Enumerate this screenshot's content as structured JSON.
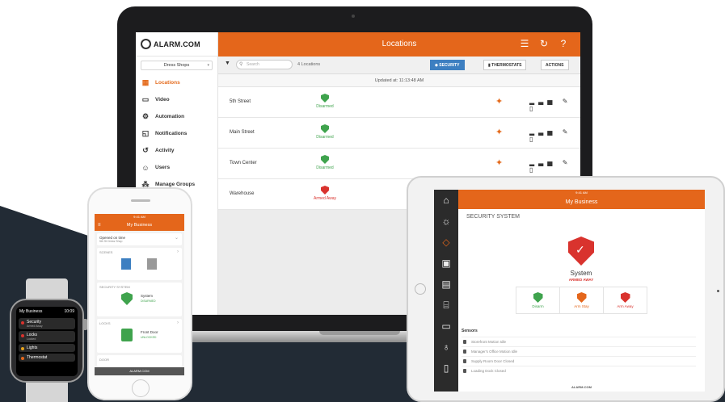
{
  "colors": {
    "brand": "#e4661b",
    "green": "#3fa34d",
    "red": "#d9332e",
    "blue": "#3d7fc1"
  },
  "laptop": {
    "logo_text": "ALARM.COM",
    "account_select": "Dress Shops",
    "nav": [
      {
        "label": "Locations",
        "icon": "building-icon"
      },
      {
        "label": "Video",
        "icon": "video-camera-icon"
      },
      {
        "label": "Automation",
        "icon": "automation-icon"
      },
      {
        "label": "Notifications",
        "icon": "notification-icon"
      },
      {
        "label": "Activity",
        "icon": "history-icon"
      },
      {
        "label": "Users",
        "icon": "users-icon"
      },
      {
        "label": "Manage Groups",
        "icon": "groups-icon"
      }
    ],
    "header_title": "Locations",
    "toolbar": {
      "search_placeholder": "Search",
      "count": "4 Locations",
      "tab_security": "SECURITY",
      "tab_thermostats": "THERMOSTATS",
      "tab_actions": "ACTIONS"
    },
    "updated": "Updated at: 11:13:48 AM",
    "rows": [
      {
        "name": "5th Street",
        "status": "Disarmed",
        "state": "green"
      },
      {
        "name": "Main Street",
        "status": "Disarmed",
        "state": "green"
      },
      {
        "name": "Town Center",
        "status": "Disarmed",
        "state": "green"
      },
      {
        "name": "Warehouse",
        "status": "Armed Away",
        "state": "red"
      }
    ]
  },
  "tablet": {
    "status_time": "9:41 AM",
    "header_title": "My Business",
    "section": "SECURITY SYSTEM",
    "system_label": "System",
    "system_state": "ARMED AWAY",
    "buttons": [
      "Disarm",
      "Arm Stay",
      "Arm Away"
    ],
    "sensors_heading": "Sensors",
    "sensors": [
      "Storefront Motion Idle",
      "Manager's Office Motion Idle",
      "Supply Room Door Closed",
      "Loading Dock Closed"
    ],
    "footer": "ALARM.COM"
  },
  "phone": {
    "status_time": "9:41 AM",
    "header_title": "My Business",
    "opened": "Opened on time",
    "opened_sub": "5th St Dress Shop",
    "scenes_label": "SCENES",
    "security_label": "SECURITY SYSTEM",
    "system_label": "System",
    "system_state": "DISARMED",
    "locks_label": "LOCKS",
    "lock_name": "Front Door",
    "lock_state": "UNLOCKED",
    "doors_label": "DOOR",
    "footer": "ALARM.COM"
  },
  "watch": {
    "title": "My Business",
    "time": "10:09",
    "items": [
      {
        "label": "Security",
        "sub": "Armed Away",
        "color": "#d9332e"
      },
      {
        "label": "Locks",
        "sub": "Locked",
        "color": "#d9332e"
      },
      {
        "label": "Lights",
        "sub": "",
        "color": "#e4a21b"
      },
      {
        "label": "Thermostat",
        "sub": "",
        "color": "#e4661b"
      }
    ]
  }
}
